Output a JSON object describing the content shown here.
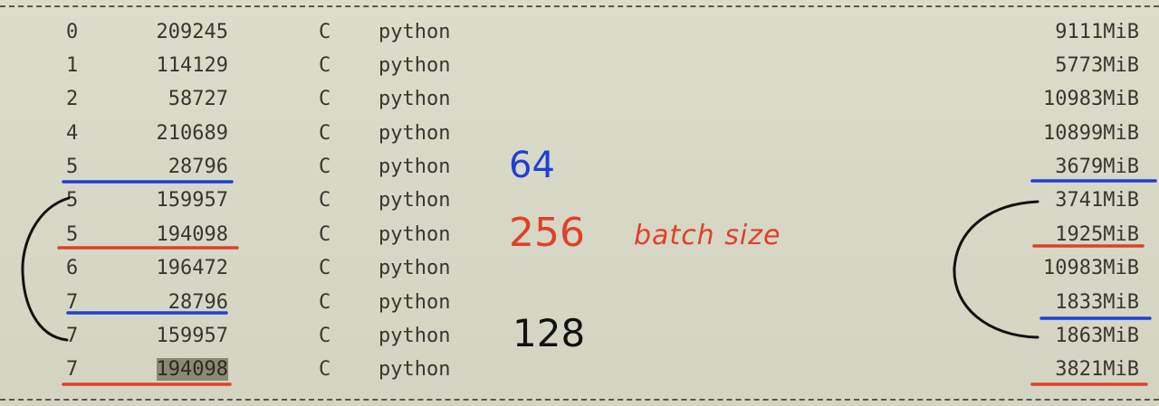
{
  "processes": [
    {
      "gpu": "0",
      "pid": "209245",
      "type": "C",
      "name": "python",
      "mem": "9111MiB"
    },
    {
      "gpu": "1",
      "pid": "114129",
      "type": "C",
      "name": "python",
      "mem": "5773MiB"
    },
    {
      "gpu": "2",
      "pid": "58727",
      "type": "C",
      "name": "python",
      "mem": "10983MiB"
    },
    {
      "gpu": "4",
      "pid": "210689",
      "type": "C",
      "name": "python",
      "mem": "10899MiB"
    },
    {
      "gpu": "5",
      "pid": "28796",
      "type": "C",
      "name": "python",
      "mem": "3679MiB"
    },
    {
      "gpu": "5",
      "pid": "159957",
      "type": "C",
      "name": "python",
      "mem": "3741MiB"
    },
    {
      "gpu": "5",
      "pid": "194098",
      "type": "C",
      "name": "python",
      "mem": "1925MiB"
    },
    {
      "gpu": "6",
      "pid": "196472",
      "type": "C",
      "name": "python",
      "mem": "10983MiB"
    },
    {
      "gpu": "7",
      "pid": "28796",
      "type": "C",
      "name": "python",
      "mem": "1833MiB"
    },
    {
      "gpu": "7",
      "pid": "159957",
      "type": "C",
      "name": "python",
      "mem": "1863MiB"
    },
    {
      "gpu": "7",
      "pid": "194098",
      "type": "C",
      "name": "python",
      "mem": "3821MiB"
    }
  ],
  "annotations": {
    "blue_label": "64",
    "red_label": "256",
    "red_note": "batch size",
    "black_label": "128"
  },
  "colors": {
    "blue_ink": "#1e3fd8",
    "red_ink": "#e0402a",
    "black_ink": "#111111",
    "selection_highlight": "#8a8a72"
  }
}
